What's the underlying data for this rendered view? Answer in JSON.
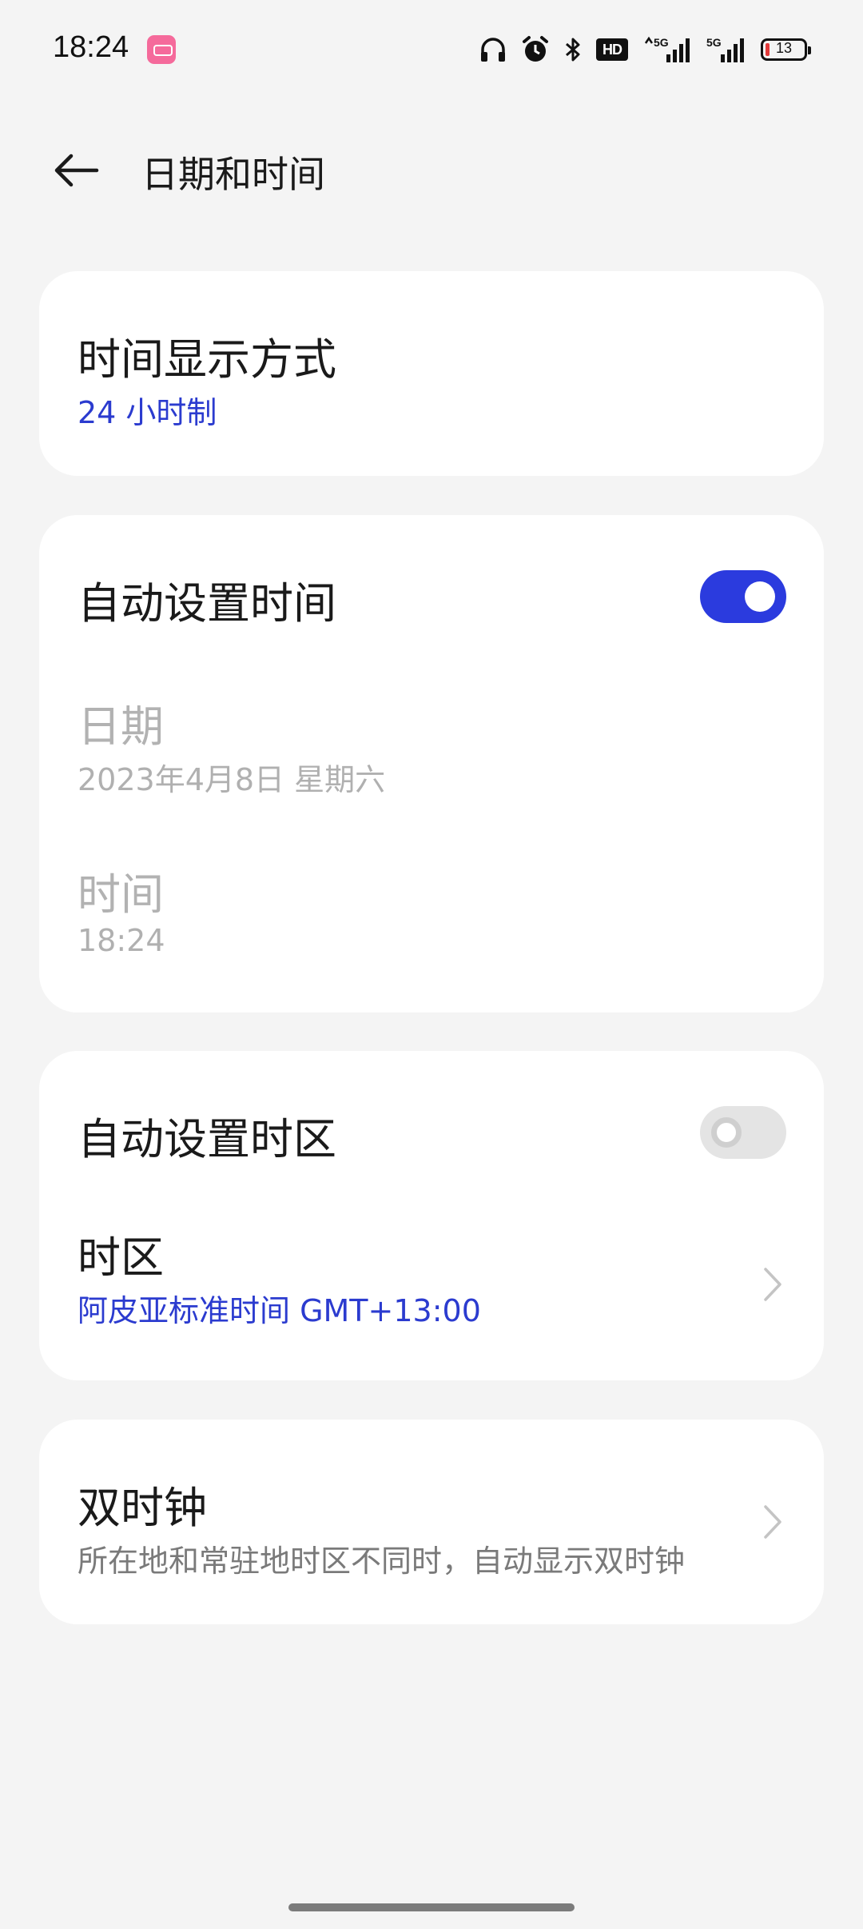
{
  "status_bar": {
    "time": "18:24",
    "hd_label": "HD",
    "battery_percent": "13",
    "icons": [
      "app-badge-icon",
      "headphones-icon",
      "alarm-icon",
      "bluetooth-icon",
      "hd-voice-icon",
      "signal-5g-1-icon",
      "signal-5g-2-icon",
      "battery-icon"
    ]
  },
  "header": {
    "title": "日期和时间",
    "back_icon": "back-arrow-icon"
  },
  "time_format": {
    "title": "时间显示方式",
    "value": "24 小时制"
  },
  "auto_time": {
    "title": "自动设置时间",
    "enabled": true,
    "date_title": "日期",
    "date_value": "2023年4月8日 星期六",
    "time_title": "时间",
    "time_value": "18:24"
  },
  "auto_timezone": {
    "title": "自动设置时区",
    "enabled": false,
    "timezone_title": "时区",
    "timezone_value": "阿皮亚标准时间 GMT+13:00"
  },
  "dual_clock": {
    "title": "双时钟",
    "description": "所在地和常驻地时区不同时，自动显示双时钟"
  },
  "colors": {
    "accent": "#2b3bde",
    "link_text": "#2b3bcf",
    "background": "#f4f4f4",
    "card": "#ffffff",
    "battery_low": "#e23a3a"
  }
}
